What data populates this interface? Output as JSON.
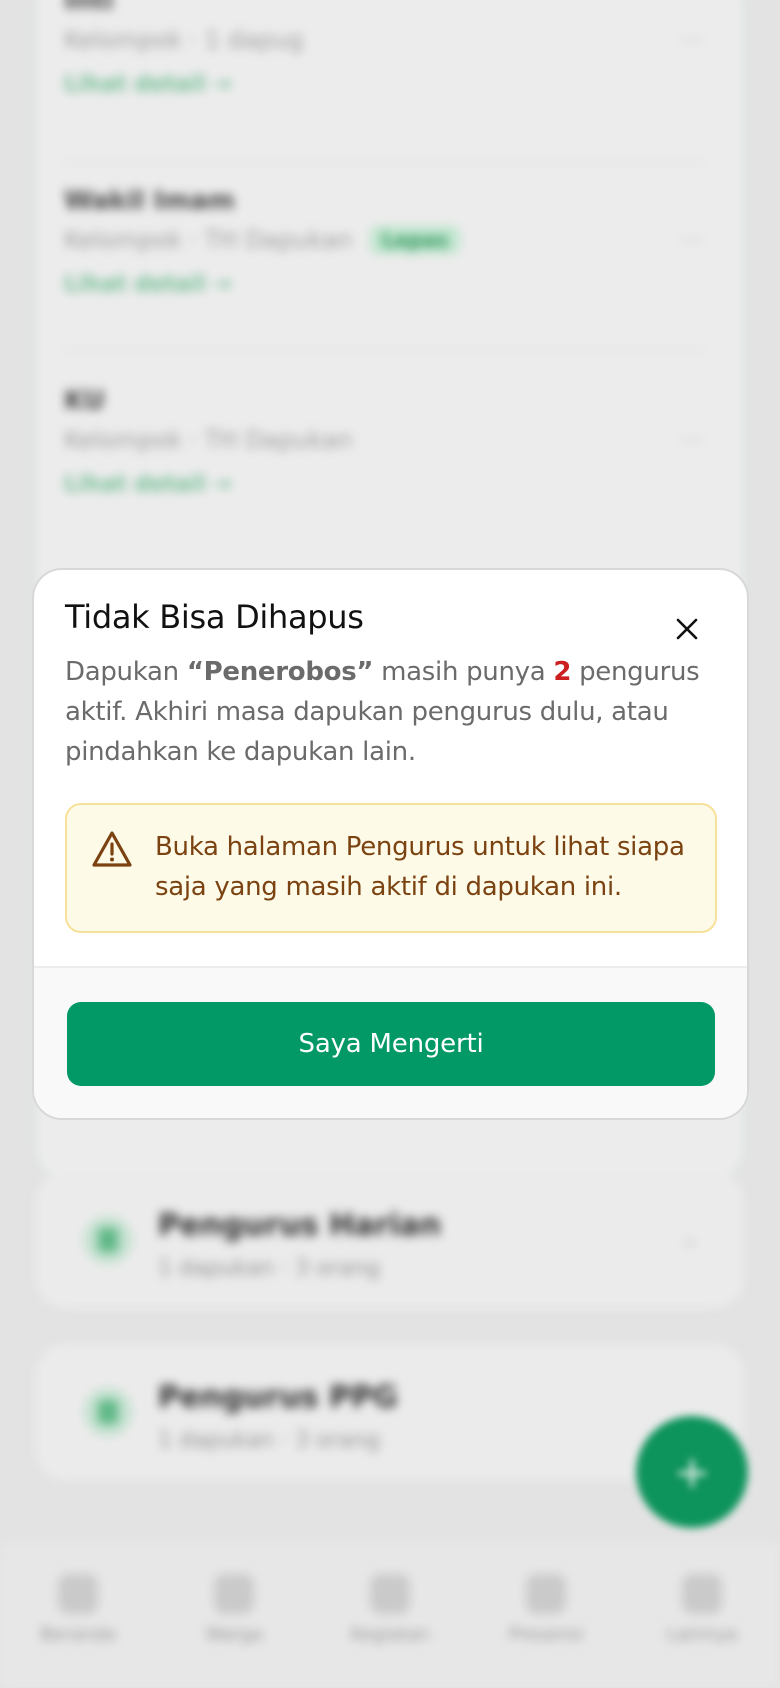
{
  "background": {
    "items": [
      {
        "title": "Inti",
        "subtitle": "Kelompok · 1 dapug",
        "link": "Lihat detail →"
      },
      {
        "title": "Wakil Imam",
        "subtitle": "Kelompok · TH Dapukan",
        "badge": "Lepas",
        "link": "Lihat detail →"
      },
      {
        "title": "KU",
        "subtitle": "Kelompok · TH Dapukan",
        "link": "Lihat detail →"
      }
    ],
    "sections": [
      {
        "title": "Pengurus Harian",
        "subtitle": "1 dapukan · 3 orang"
      },
      {
        "title": "Pengurus PPG",
        "subtitle": "1 dapukan · 3 orang"
      }
    ],
    "fab_label": "+",
    "nav": [
      "Beranda",
      "Warga",
      "Kegiatan",
      "Presensi",
      "Lainnya"
    ]
  },
  "modal": {
    "title": "Tidak Bisa Dihapus",
    "body_prefix": "Dapukan ",
    "dapukan_name": "“Penerobos”",
    "body_mid": " masih punya ",
    "active_count": "2",
    "body_suffix": " pengurus aktif. Akhiri masa dapukan pengurus dulu, atau pindahkan ke dapukan lain.",
    "warning_text": "Buka halaman Pengurus untuk lihat siapa saja yang masih aktif di dapukan ini.",
    "confirm_label": "Saya Mengerti"
  },
  "colors": {
    "primary": "#029966",
    "count": "#cc1f1f",
    "warning_bg": "#fefae8",
    "warning_border": "#f6e19a",
    "warning_text": "#7b4311"
  }
}
